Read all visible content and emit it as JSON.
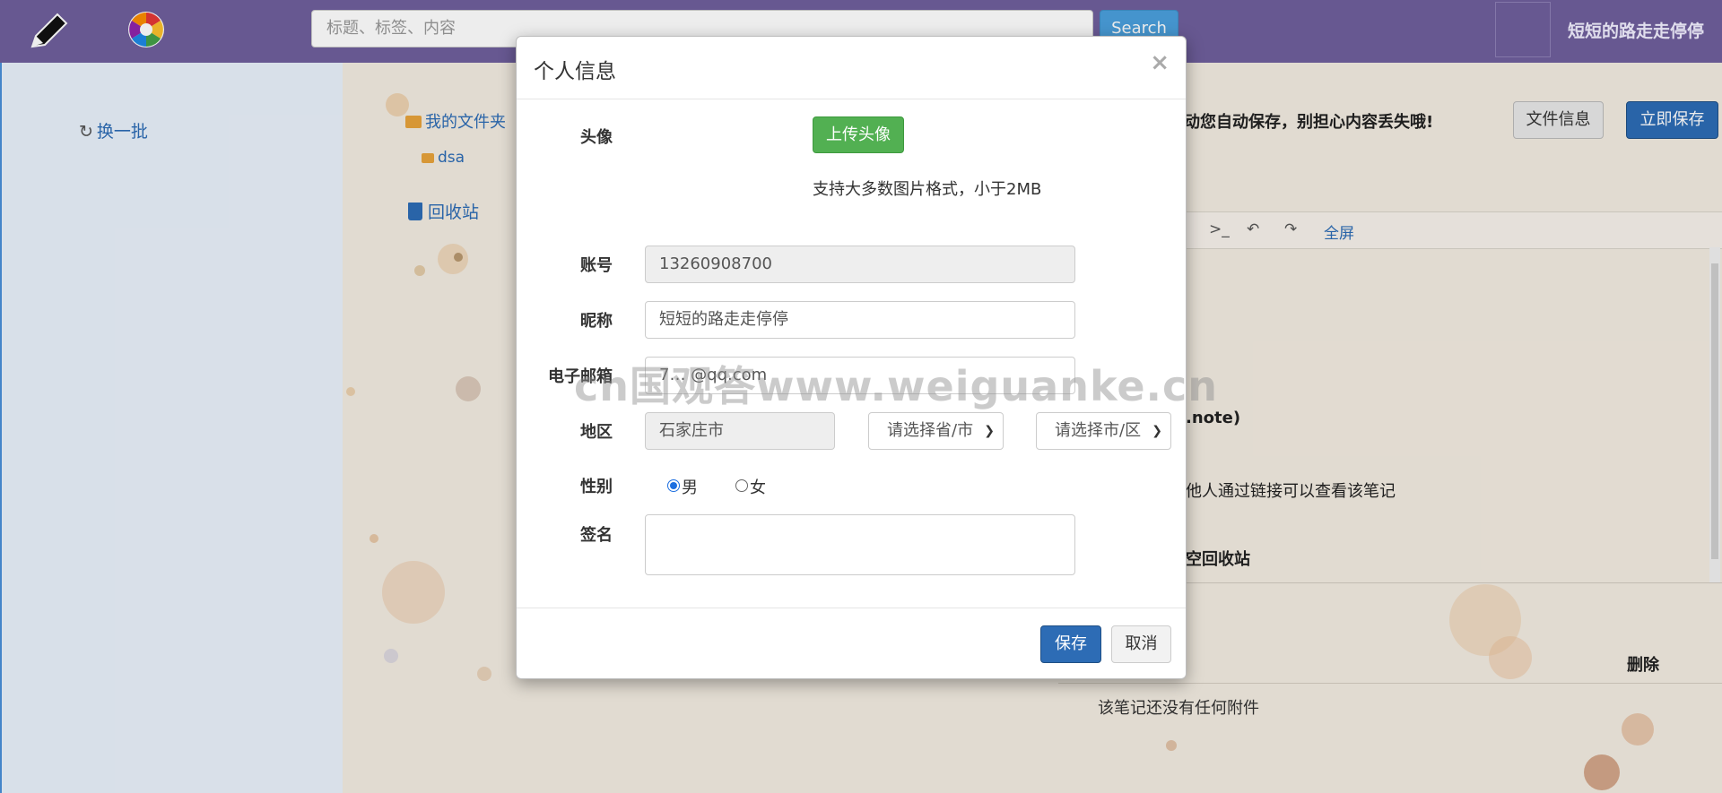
{
  "header": {
    "search_placeholder": "标题、标签、内容",
    "search_button": "Search",
    "user_name": "短短的路走走停停"
  },
  "sidebar": {
    "refresh_label": "换一批",
    "folders": {
      "root_label": "我的文件夹",
      "child_label": "dsa",
      "recycle_label": "回收站"
    }
  },
  "editor": {
    "autosave_notice": "动您自动保存，别担心内容丢失哦!",
    "file_info_button": "文件信息",
    "save_now_button": "立即保存",
    "toolbar": {
      "terminal_symbol": ">_",
      "fullscreen": "全屏"
    },
    "visible_fragments": [
      ".note)",
      "他人通过链接可以查看该笔记",
      "空回收站"
    ],
    "attachments": {
      "delete_header": "删除",
      "empty_text": "该笔记还没有任何附件"
    }
  },
  "modal": {
    "title": "个人信息",
    "close_symbol": "×",
    "avatar": {
      "label": "头像",
      "upload_button": "上传头像",
      "hint": "支持大多数图片格式，小于2MB"
    },
    "account": {
      "label": "账号",
      "value": "13260908700"
    },
    "nickname": {
      "label": "昵称",
      "value": "短短的路走走停停"
    },
    "email": {
      "label": "电子邮箱",
      "value": "7… @qq.com"
    },
    "region": {
      "label": "地区",
      "value": "石家庄市",
      "province_select": "请选择省/市",
      "city_select": "请选择市/区"
    },
    "gender": {
      "label": "性别",
      "options": [
        "男",
        "女"
      ],
      "selected": "男"
    },
    "signature": {
      "label": "签名",
      "value": ""
    },
    "save_button": "保存",
    "cancel_button": "取消"
  },
  "watermark": "cn国观答www.weiguanke.cn",
  "colors": {
    "topbar": "#6f5f9c",
    "primary": "#2d6cb5",
    "success": "#52b052",
    "search_button": "#4ba0dd"
  }
}
